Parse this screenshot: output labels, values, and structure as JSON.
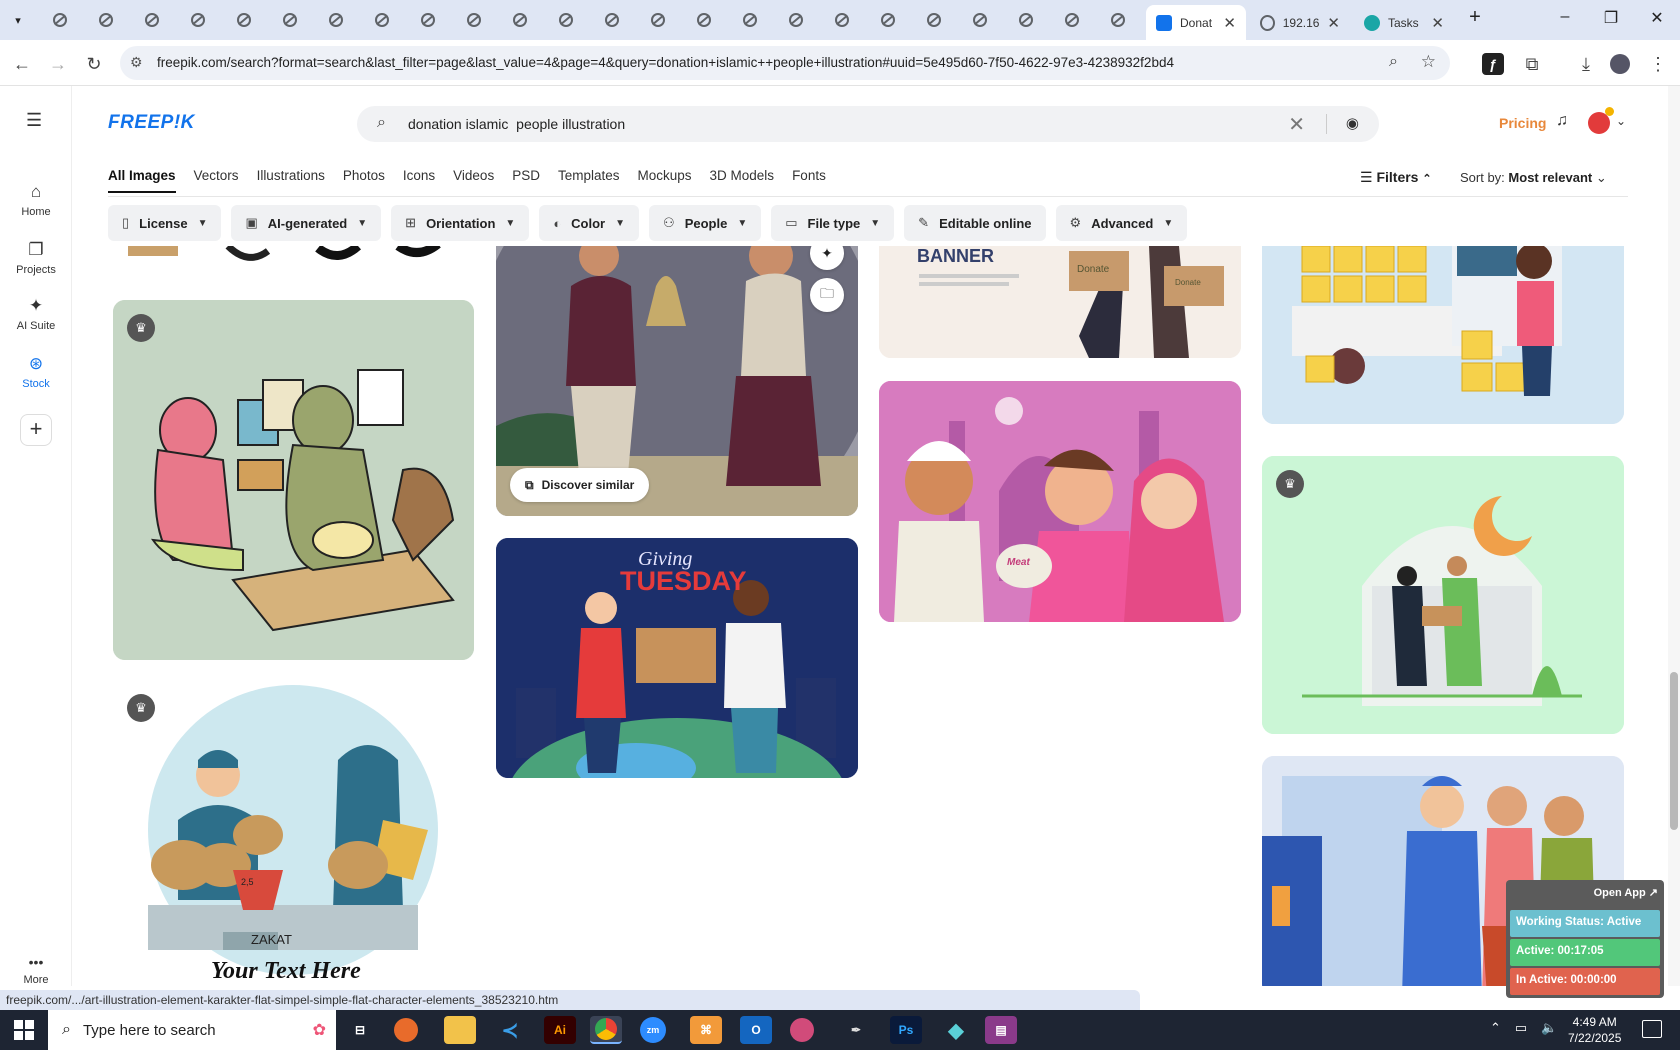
{
  "browser": {
    "tabs": [
      {
        "title": "Donat",
        "active": true
      },
      {
        "title": "192.16",
        "active": false
      },
      {
        "title": "Tasks",
        "active": false
      }
    ],
    "url": "freepik.com/search?format=search&last_filter=page&last_value=4&page=4&query=donation+islamic++people+illustration#uuid=5e495d60-7f50-4622-97e3-4238932f2bd4",
    "window_controls": [
      "–",
      "❐",
      "✕"
    ],
    "new_tab": "+"
  },
  "rail": {
    "items": [
      {
        "label": "Home",
        "icon": "home-icon",
        "glyph": "⌂"
      },
      {
        "label": "Projects",
        "icon": "projects-icon",
        "glyph": "❐"
      },
      {
        "label": "AI Suite",
        "icon": "ai-suite-icon",
        "glyph": "✦"
      },
      {
        "label": "Stock",
        "icon": "stock-icon",
        "glyph": "⊛"
      }
    ],
    "more_label": "More"
  },
  "header": {
    "logo": "FREEP!K",
    "search_value": "donation islamic  people illustration",
    "pricing": "Pricing"
  },
  "categories": [
    "All Images",
    "Vectors",
    "Illustrations",
    "Photos",
    "Icons",
    "Videos",
    "PSD",
    "Templates",
    "Mockups",
    "3D Models",
    "Fonts"
  ],
  "toolbar": {
    "filters": "Filters",
    "sort_label": "Sort by:",
    "sort_value": "Most relevant"
  },
  "chips": [
    {
      "label": "License",
      "icon": "license-icon",
      "glyph": "▯"
    },
    {
      "label": "AI-generated",
      "icon": "ai-generated-icon",
      "glyph": "▣"
    },
    {
      "label": "Orientation",
      "icon": "orientation-icon",
      "glyph": "⊞"
    },
    {
      "label": "Color",
      "icon": "color-icon",
      "glyph": "◐"
    },
    {
      "label": "People",
      "icon": "people-icon",
      "glyph": "⚇"
    },
    {
      "label": "File type",
      "icon": "file-type-icon",
      "glyph": "▭"
    },
    {
      "label": "Editable online",
      "icon": "edit-icon",
      "glyph": "✎"
    },
    {
      "label": "Advanced",
      "icon": "advanced-icon",
      "glyph": "⚙"
    }
  ],
  "cards": {
    "discover_similar": "Discover similar",
    "banner_text": "BANNER",
    "donate_box_1": "Donate",
    "donate_box_2": "Donate",
    "giving": "Giving",
    "tuesday": "TUESDAY",
    "meat_label": "Meat",
    "zakat_label": "ZAKAT",
    "scale_label": "2,5",
    "your_text": "Your Text Here"
  },
  "status_url": "freepik.com/.../art-illustration-element-karakter-flat-simpel-simple-flat-character-elements_38523210.htm",
  "tracker": {
    "open_app": "Open App ↗",
    "working_status": "Working Status: Active",
    "active": "Active: 00:17:05",
    "inactive": "In Active: 00:00:00"
  },
  "taskbar": {
    "search_placeholder": "Type here to search",
    "time": "4:49 AM",
    "date": "7/22/2025"
  },
  "colors": {
    "brand": "#1273eb",
    "pricing": "#e8883b",
    "status_active": "#52c77a",
    "status_inactive": "#e0634e",
    "status_working": "#6cc0cf"
  }
}
